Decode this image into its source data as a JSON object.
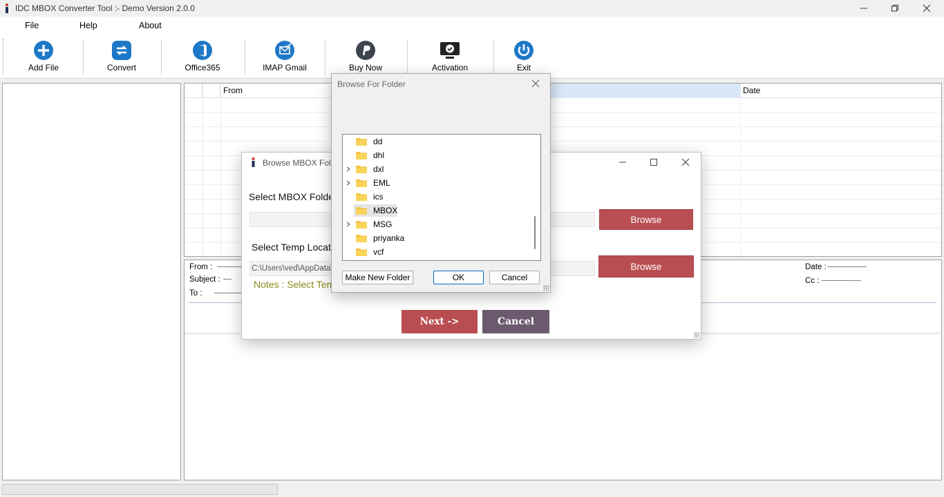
{
  "window": {
    "title": "IDC MBOX Converter Tool  :- Demo Version 2.0.0"
  },
  "menu": {
    "items": [
      "File",
      "Help",
      "About"
    ]
  },
  "toolbar": {
    "buttons": [
      {
        "label": "Add File",
        "icon": "add-icon"
      },
      {
        "label": "Convert",
        "icon": "convert-icon"
      },
      {
        "label": "Office365",
        "icon": "office365-icon"
      },
      {
        "label": "IMAP Gmail",
        "icon": "imap-gmail-icon"
      },
      {
        "label": "Buy Now",
        "icon": "paypal-icon"
      },
      {
        "label": "Activation",
        "icon": "activation-icon"
      },
      {
        "label": "Exit",
        "icon": "power-icon"
      }
    ]
  },
  "grid": {
    "columns": [
      "From",
      "Date"
    ]
  },
  "preview": {
    "from_label": "From :",
    "from_value": "---------------",
    "subject_label": "Subject :",
    "subject_value": "----",
    "to_label": "To :",
    "to_value": "-------------",
    "date_label": "Date :",
    "date_value": "-------------------",
    "cc_label": "Cc :",
    "cc_value": "-------------------"
  },
  "mbox_dialog": {
    "title": "Browse MBOX Folder",
    "select_mbox_label": "Select MBOX Folder",
    "select_temp_label": "Select Temp Location",
    "temp_path": "C:\\Users\\ved\\AppData\\",
    "browse_label": "Browse",
    "notes": "Notes :  Select Temp",
    "next_label": "Next  ->",
    "cancel_label": "Cancel"
  },
  "folder_dialog": {
    "title": "Browse For Folder",
    "folders": [
      {
        "name": "dd",
        "expandable": false,
        "selected": false
      },
      {
        "name": "dhl",
        "expandable": false,
        "selected": false
      },
      {
        "name": "dxl",
        "expandable": true,
        "selected": false
      },
      {
        "name": "EML",
        "expandable": true,
        "selected": false
      },
      {
        "name": "ics",
        "expandable": false,
        "selected": false
      },
      {
        "name": "MBOX",
        "expandable": false,
        "selected": true
      },
      {
        "name": "MSG",
        "expandable": true,
        "selected": false
      },
      {
        "name": "priyanka",
        "expandable": false,
        "selected": false
      },
      {
        "name": "vcf",
        "expandable": false,
        "selected": false
      }
    ],
    "make_new_folder_label": "Make New Folder",
    "ok_label": "OK",
    "cancel_label": "Cancel"
  },
  "colors": {
    "accent_blue": "#1e78c8",
    "browse_red": "#b94e52",
    "cancel_purple": "#6b5a6e",
    "notes_olive": "#8a8a1a"
  }
}
